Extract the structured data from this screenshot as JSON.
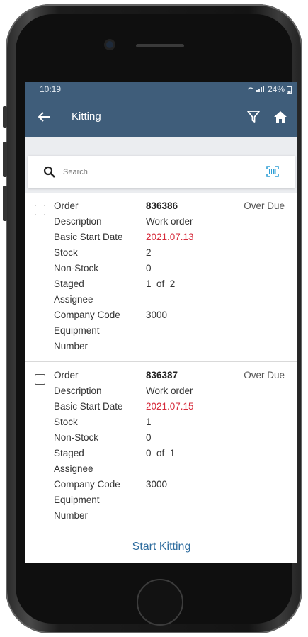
{
  "status_bar": {
    "time": "10:19",
    "indicators": "📶 24%"
  },
  "app_bar": {
    "title": "Kitting",
    "back_icon": "arrow-left-icon",
    "filter_icon": "filter-icon",
    "home_icon": "home-icon"
  },
  "search": {
    "placeholder": "Search",
    "scan_icon": "barcode-scan-icon"
  },
  "orders": [
    {
      "status": "Over Due",
      "fields": [
        {
          "label": "Order",
          "value": "836386",
          "style": "bold"
        },
        {
          "label": "Description",
          "value": "Work order"
        },
        {
          "label": "Basic Start Date",
          "value": "2021.07.13",
          "style": "red"
        },
        {
          "label": "Stock",
          "value": "2"
        },
        {
          "label": "Non-Stock",
          "value": "0"
        },
        {
          "label": "Staged",
          "value": "1  of  2"
        },
        {
          "label": "Assignee",
          "value": ""
        },
        {
          "label": "Company Code",
          "value": "3000"
        },
        {
          "label": "Equipment Number",
          "value": ""
        }
      ]
    },
    {
      "status": "Over Due",
      "fields": [
        {
          "label": "Order",
          "value": "836387",
          "style": "bold"
        },
        {
          "label": "Description",
          "value": "Work order"
        },
        {
          "label": "Basic Start Date",
          "value": "2021.07.15",
          "style": "red"
        },
        {
          "label": "Stock",
          "value": "1"
        },
        {
          "label": "Non-Stock",
          "value": "0"
        },
        {
          "label": "Staged",
          "value": "0  of  1"
        },
        {
          "label": "Assignee",
          "value": ""
        },
        {
          "label": "Company Code",
          "value": "3000"
        },
        {
          "label": "Equipment Number",
          "value": ""
        }
      ]
    }
  ],
  "footer": {
    "start_label": "Start Kitting"
  },
  "colors": {
    "header": "#3f5d7a",
    "accent": "#2f6d9f",
    "date_red": "#d62b3b"
  }
}
